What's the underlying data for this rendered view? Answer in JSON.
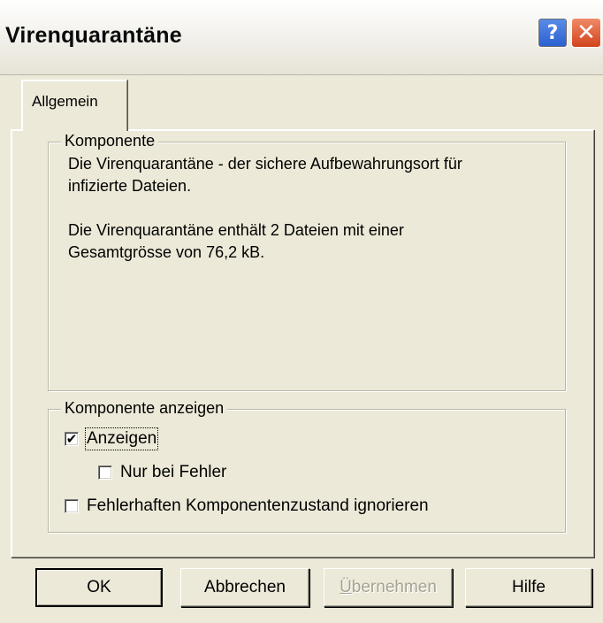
{
  "window": {
    "title": "Virenquarantäne"
  },
  "titlebar": {
    "help_glyph": "?",
    "close_glyph": "✕"
  },
  "tabs": [
    {
      "label": "Allgemein"
    }
  ],
  "komponente": {
    "legend": "Komponente",
    "line1": "Die Virenquarantäne - der sichere Aufbewahrungsort für",
    "line2": "infizierte Dateien.",
    "line3": "Die Virenquarantäne enthält 2 Dateien mit einer",
    "line4": "Gesamtgrösse von 76,2 kB."
  },
  "anzeigen_group": {
    "legend": "Komponente anzeigen",
    "checkboxes": [
      {
        "label": "Anzeigen",
        "checked": true
      },
      {
        "label": "Nur bei Fehler",
        "checked": false
      },
      {
        "label": "Fehlerhaften Komponentenzustand ignorieren",
        "checked": false
      }
    ]
  },
  "buttons": {
    "ok": "OK",
    "cancel": "Abbrechen",
    "apply_first": "Ü",
    "apply_rest": "bernehmen",
    "help": "Hilfe"
  },
  "colors": {
    "face": "#ece9d8",
    "disabled_text": "#a6a394",
    "help_blue": "#2a5fd0",
    "close_red": "#d1431d"
  }
}
